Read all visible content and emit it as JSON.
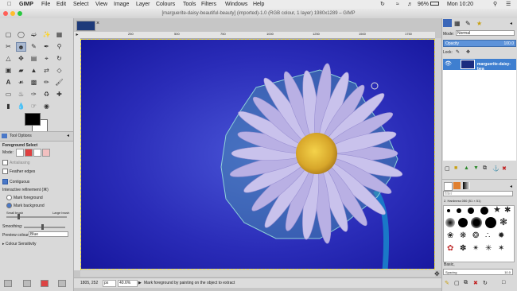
{
  "menubar": {
    "apple_icon": "apple-icon",
    "app": "GIMP",
    "items": [
      "File",
      "Edit",
      "Select",
      "View",
      "Image",
      "Layer",
      "Colours",
      "Tools",
      "Filters",
      "Windows",
      "Help"
    ],
    "battery": "96%",
    "clock": "Mon 10:20"
  },
  "window": {
    "title": "[marguerite-daisy-beautiful-beauty] (imported)-1.0 (RGB colour, 1 layer) 1980x1289 – GIMP"
  },
  "ruler": {
    "ticks": [
      "250",
      "500",
      "750",
      "1000",
      "1250",
      "1500",
      "1750"
    ]
  },
  "tool_options": {
    "tab_label": "Tool Options",
    "title": "Foreground Select",
    "mode_label": "Mode:",
    "antialiasing": "Antialiasing",
    "feather": "Feather edges",
    "contiguous": "Contiguous",
    "refinement": "Interactive refinement  (⌘)",
    "mark_fg": "Mark foreground",
    "mark_bg": "Mark background",
    "small_brush": "Small brush",
    "large_brush": "Large brush",
    "smoothing": "Smoothing:",
    "preview_colour": "Preview colour:",
    "preview_value": "Blue",
    "colour_sensitivity": "Colour Sensitivity"
  },
  "status": {
    "coords": "1805, 252",
    "unit": "px",
    "zoom": "40.6%",
    "message": "Mark foreground by painting on the object to extract"
  },
  "layers": {
    "mode_label": "Mode:",
    "mode_value": "Normal",
    "opacity_label": "Opacity",
    "opacity_value": "100.0",
    "lock_label": "Lock:",
    "layer_name": "marguerite-daisy-bea"
  },
  "brushes": {
    "filter": "filter",
    "name": "2. Hardness 050 (51 × 51)",
    "preset": "Basic,",
    "spacing_label": "Spacing",
    "spacing_value": "10.0"
  },
  "colors": {
    "accent": "#3f7fd0",
    "canvas_bg": "#2526b0"
  }
}
